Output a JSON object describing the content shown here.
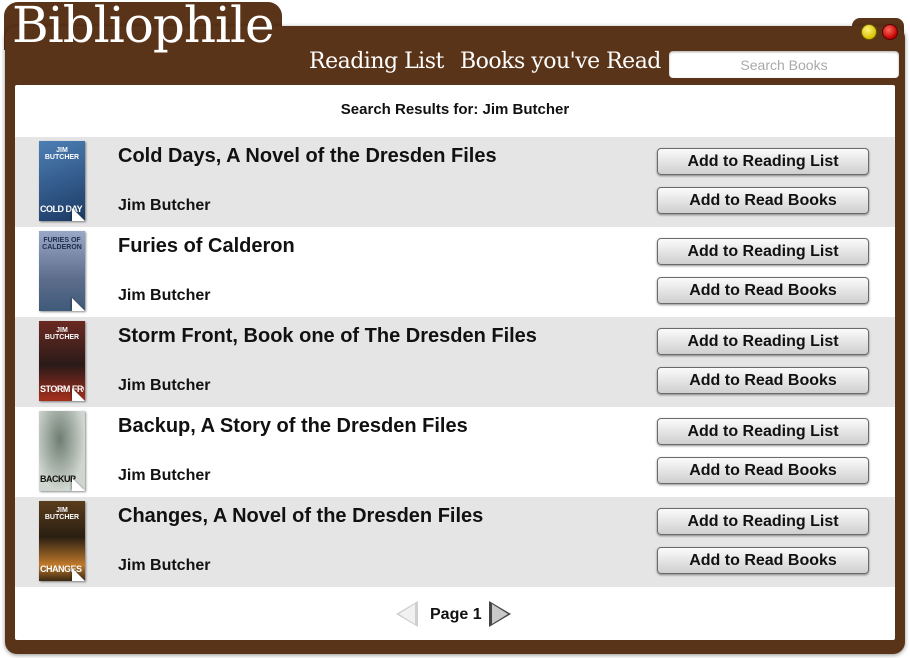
{
  "app": {
    "logo": "Bibliophile",
    "nav": {
      "reading_list": "Reading List",
      "books_read": "Books you've Read"
    },
    "search": {
      "placeholder": "Search Books",
      "value": ""
    }
  },
  "results_header": "Search Results for: Jim Butcher",
  "books": [
    {
      "title": "Cold Days, A Novel of the Dresden Files",
      "author": "Jim Butcher",
      "add_list_label": "Add to Reading List",
      "add_read_label": "Add to Read Books",
      "cover": {
        "top": "JIM BUTCHER",
        "bottom": "COLD DAY",
        "color": "#2c5a8e"
      }
    },
    {
      "title": "Furies of Calderon",
      "author": "Jim Butcher",
      "add_list_label": "Add to Reading List",
      "add_read_label": "Add to Read Books",
      "cover": {
        "top": "FURIES OF CALDERON",
        "bottom": "",
        "color": "#7e8fb4"
      }
    },
    {
      "title": "Storm Front, Book one of The Dresden Files",
      "author": "Jim Butcher",
      "add_list_label": "Add to Reading List",
      "add_read_label": "Add to Read Books",
      "cover": {
        "top": "JIM BUTCHER",
        "bottom": "STORM FRONT",
        "color": "#3b2420"
      }
    },
    {
      "title": "Backup, A Story of the Dresden Files",
      "author": "Jim Butcher",
      "add_list_label": "Add to Reading List",
      "add_read_label": "Add to Read Books",
      "cover": {
        "top": "",
        "bottom": "BACKUP",
        "color": "#b8c2ba"
      }
    },
    {
      "title": "Changes, A Novel of the Dresden Files",
      "author": "Jim Butcher",
      "add_list_label": "Add to Reading List",
      "add_read_label": "Add to Read Books",
      "cover": {
        "top": "JIM BUTCHER",
        "bottom": "CHANGES",
        "color": "#3a2a14"
      }
    }
  ],
  "pagination": {
    "label": "Page 1"
  },
  "colors": {
    "frame": "#5a3419",
    "row_shade": "#e5e5e5",
    "traffic_yellow": "#e8d200",
    "traffic_red": "#d40000"
  },
  "icons": {
    "prev": "chevron-left-icon",
    "next": "chevron-right-icon"
  }
}
